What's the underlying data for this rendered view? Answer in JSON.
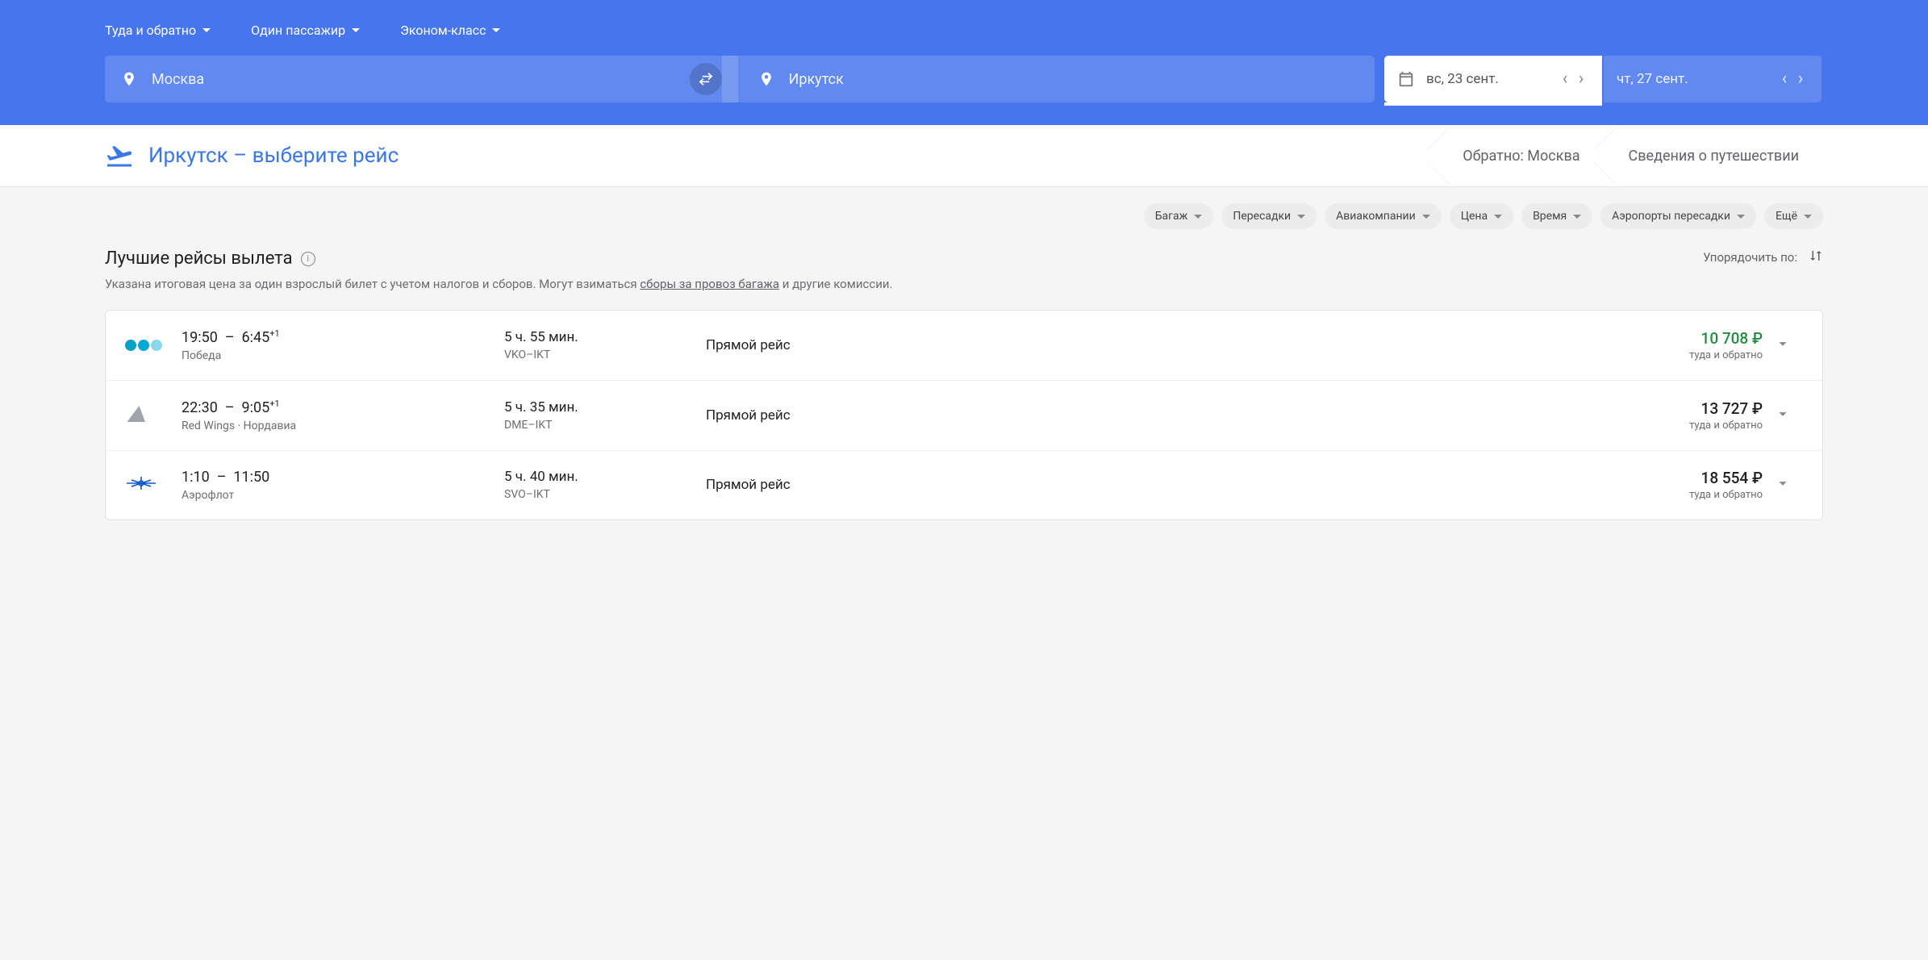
{
  "header": {
    "trip_type": "Туда и обратно",
    "passengers": "Один пассажир",
    "cabin": "Эконом-класс",
    "from": "Москва",
    "to": "Иркутск",
    "date_depart": "вс, 23 сент.",
    "date_return": "чт, 27 сент."
  },
  "steps": {
    "active": "Иркутск – выберите рейс",
    "return": "Обратно: Москва",
    "summary": "Сведения о путешествии"
  },
  "filters": {
    "baggage": "Багаж",
    "stops": "Пересадки",
    "airlines": "Авиакомпании",
    "price": "Цена",
    "time": "Время",
    "layover_airports": "Аэропорты пересадки",
    "more": "Ещё"
  },
  "section": {
    "title": "Лучшие рейсы вылета",
    "subtitle_pre": "Указана итоговая цена за один взрослый билет с учетом налогов и сборов. Могут взиматься ",
    "subtitle_link": "сборы за провоз багажа",
    "subtitle_post": " и другие комиссии.",
    "sort_label": "Упорядочить по:"
  },
  "flights": [
    {
      "depart": "19:50",
      "arrive": "6:45",
      "next_day": "+1",
      "airline": "Победа",
      "duration": "5 ч. 55 мин.",
      "route": "VKO–IKT",
      "stops": "Прямой рейс",
      "price": "10 708 ₽",
      "price_class": "green",
      "trip_kind": "туда и обратно",
      "logo": "pobeda"
    },
    {
      "depart": "22:30",
      "arrive": "9:05",
      "next_day": "+1",
      "airline": "Red Wings  ·  Нордавиа",
      "duration": "5 ч. 35 мин.",
      "route": "DME–IKT",
      "stops": "Прямой рейс",
      "price": "13 727 ₽",
      "price_class": "",
      "trip_kind": "туда и обратно",
      "logo": "tail"
    },
    {
      "depart": "1:10",
      "arrive": "11:50",
      "next_day": "",
      "airline": "Аэрофлот",
      "duration": "5 ч. 40 мин.",
      "route": "SVO–IKT",
      "stops": "Прямой рейс",
      "price": "18 554 ₽",
      "price_class": "",
      "trip_kind": "туда и обратно",
      "logo": "aeroflot"
    }
  ]
}
